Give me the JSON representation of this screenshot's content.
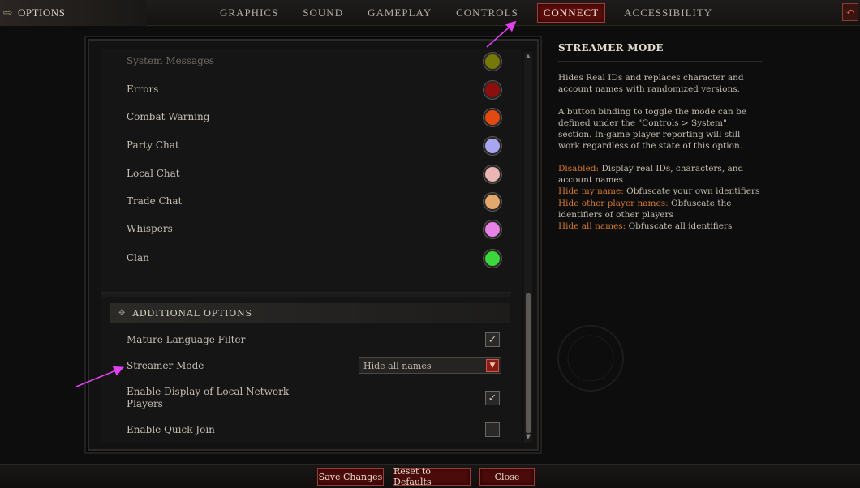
{
  "header": {
    "title": "OPTIONS",
    "tabs": [
      {
        "label": "GRAPHICS"
      },
      {
        "label": "SOUND"
      },
      {
        "label": "GAMEPLAY"
      },
      {
        "label": "CONTROLS"
      },
      {
        "label": "CONNECT",
        "active": true
      },
      {
        "label": "ACCESSIBILITY"
      }
    ]
  },
  "chat_colors": [
    {
      "label": "System Messages",
      "color": "#76780a"
    },
    {
      "label": "Errors",
      "color": "#8c0e0e"
    },
    {
      "label": "Combat Warning",
      "color": "#e24a12"
    },
    {
      "label": "Party Chat",
      "color": "#a9a6f1"
    },
    {
      "label": "Local Chat",
      "color": "#ebb5b5"
    },
    {
      "label": "Trade Chat",
      "color": "#e4a86c"
    },
    {
      "label": "Whispers",
      "color": "#e782e6"
    },
    {
      "label": "Clan",
      "color": "#3ad83c"
    }
  ],
  "additional": {
    "header": "ADDITIONAL OPTIONS",
    "mature_filter": {
      "label": "Mature Language Filter",
      "checked": true
    },
    "streamer_mode": {
      "label": "Streamer Mode",
      "value": "Hide all names"
    },
    "local_network": {
      "label_line1": "Enable Display of Local Network",
      "label_line2": "Players",
      "checked": true
    },
    "quick_join": {
      "label": "Enable Quick Join",
      "checked": false
    }
  },
  "info": {
    "title": "STREAMER MODE",
    "p1": "Hides Real IDs and replaces character and account names with randomized versions.",
    "p2": "A button binding to toggle the mode can be defined under the \"Controls > System\" section. In-game player reporting will still work regardless of the state of this option.",
    "items": [
      {
        "key": "Disabled:",
        "desc": " Display real IDs, characters, and account names"
      },
      {
        "key": "Hide my name:",
        "desc": " Obfuscate your own identifiers"
      },
      {
        "key": "Hide other player names:",
        "desc": " Obfuscate the identifiers of other players"
      },
      {
        "key": "Hide all names:",
        "desc": " Obfuscate all identifiers"
      }
    ]
  },
  "footer": {
    "save": "Save Changes",
    "reset": "Reset to Defaults",
    "close": "Close"
  }
}
